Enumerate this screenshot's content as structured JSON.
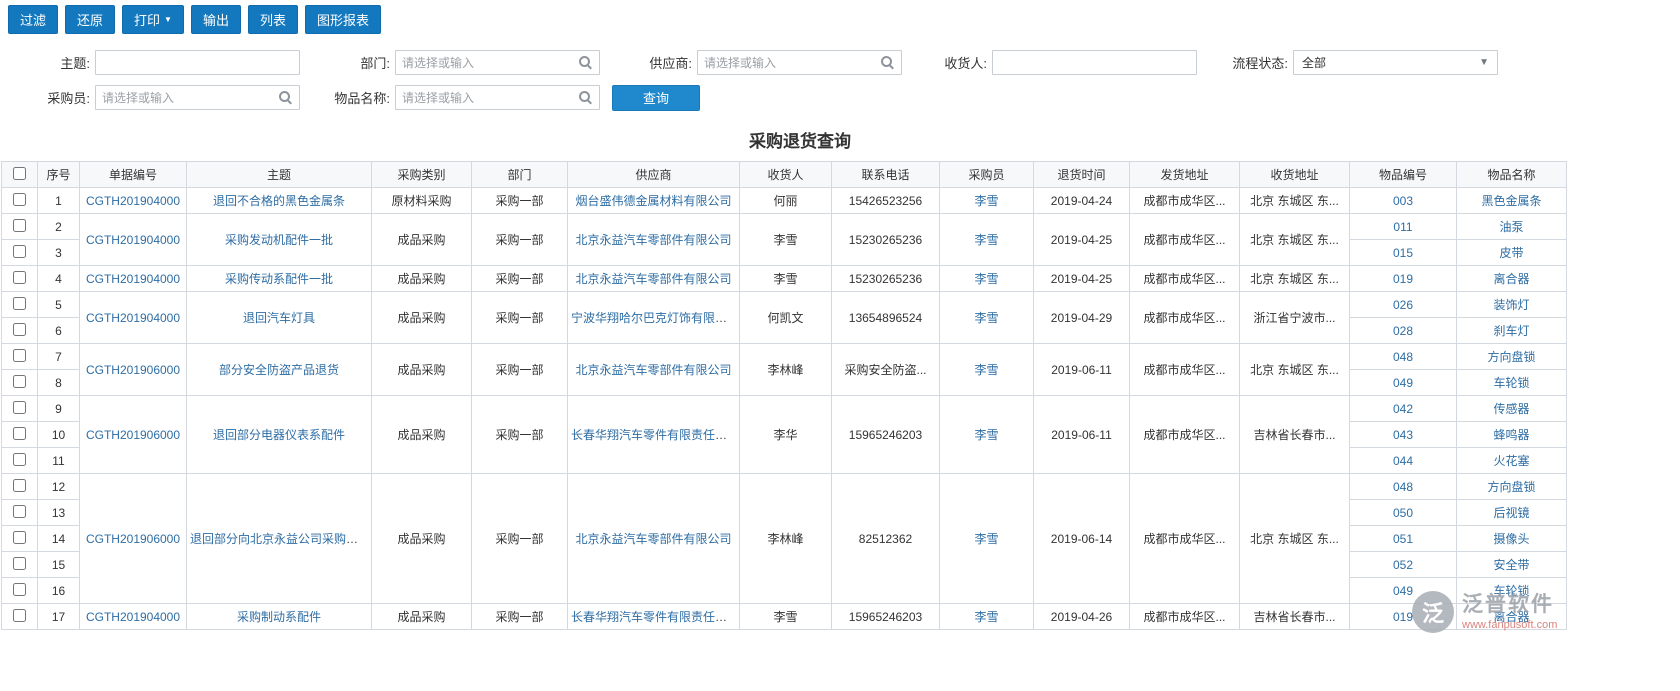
{
  "toolbar": {
    "buttons": [
      {
        "label": "过滤",
        "name": "filter-button"
      },
      {
        "label": "还原",
        "name": "restore-button"
      },
      {
        "label": "打印",
        "name": "print-button",
        "caret": true
      },
      {
        "label": "输出",
        "name": "output-button"
      },
      {
        "label": "列表",
        "name": "list-button"
      },
      {
        "label": "图形报表",
        "name": "graph-report-button"
      }
    ]
  },
  "filters": {
    "subject_label": "主题:",
    "dept_label": "部门:",
    "supplier_label": "供应商:",
    "consignee_label": "收货人:",
    "status_label": "流程状态:",
    "purchaser_label": "采购员:",
    "item_name_label": "物品名称:",
    "search_placeholder": "请选择或输入",
    "status_value": "全部",
    "query_button": "查询"
  },
  "page_title": "采购退货查询",
  "table": {
    "headers": [
      "序号",
      "单据编号",
      "主题",
      "采购类别",
      "部门",
      "供应商",
      "收货人",
      "联系电话",
      "采购员",
      "退货时间",
      "发货地址",
      "收货地址",
      "物品编号",
      "物品名称"
    ],
    "groups": [
      {
        "doc_no": "CGTH201904000",
        "subject": "退回不合格的黑色金属条",
        "category": "原材料采购",
        "dept": "采购一部",
        "supplier": "烟台盛伟德金属材料有限公司",
        "consignee": "何丽",
        "phone": "15426523256",
        "purchaser": "李雪",
        "return_date": "2019-04-24",
        "ship_address": "成都市成华区...",
        "recv_address": "北京 东城区 东...",
        "items": [
          {
            "no": "003",
            "name": "黑色金属条"
          }
        ]
      },
      {
        "doc_no": "CGTH201904000",
        "subject": "采购发动机配件一批",
        "category": "成品采购",
        "dept": "采购一部",
        "supplier": "北京永益汽车零部件有限公司",
        "consignee": "李雪",
        "phone": "15230265236",
        "purchaser": "李雪",
        "return_date": "2019-04-25",
        "ship_address": "成都市成华区...",
        "recv_address": "北京 东城区 东...",
        "items": [
          {
            "no": "011",
            "name": "油泵"
          },
          {
            "no": "015",
            "name": "皮带"
          }
        ]
      },
      {
        "doc_no": "CGTH201904000",
        "subject": "采购传动系配件一批",
        "category": "成品采购",
        "dept": "采购一部",
        "supplier": "北京永益汽车零部件有限公司",
        "consignee": "李雪",
        "phone": "15230265236",
        "purchaser": "李雪",
        "return_date": "2019-04-25",
        "ship_address": "成都市成华区...",
        "recv_address": "北京 东城区 东...",
        "items": [
          {
            "no": "019",
            "name": "离合器"
          }
        ]
      },
      {
        "doc_no": "CGTH201904000",
        "subject": "退回汽车灯具",
        "category": "成品采购",
        "dept": "采购一部",
        "supplier": "宁波华翔哈尔巴克灯饰有限公...",
        "consignee": "何凯文",
        "phone": "13654896524",
        "purchaser": "李雪",
        "return_date": "2019-04-29",
        "ship_address": "成都市成华区...",
        "recv_address": "浙江省宁波市...",
        "items": [
          {
            "no": "026",
            "name": "装饰灯"
          },
          {
            "no": "028",
            "name": "刹车灯"
          }
        ]
      },
      {
        "doc_no": "CGTH201906000",
        "subject": "部分安全防盗产品退货",
        "category": "成品采购",
        "dept": "采购一部",
        "supplier": "北京永益汽车零部件有限公司",
        "consignee": "李林峰",
        "phone": "采购安全防盗...",
        "purchaser": "李雪",
        "return_date": "2019-06-11",
        "ship_address": "成都市成华区...",
        "recv_address": "北京 东城区 东...",
        "items": [
          {
            "no": "048",
            "name": "方向盘锁"
          },
          {
            "no": "049",
            "name": "车轮锁"
          }
        ]
      },
      {
        "doc_no": "CGTH201906000",
        "subject": "退回部分电器仪表系配件",
        "category": "成品采购",
        "dept": "采购一部",
        "supplier": "长春华翔汽车零件有限责任公...",
        "consignee": "李华",
        "phone": "15965246203",
        "purchaser": "李雪",
        "return_date": "2019-06-11",
        "ship_address": "成都市成华区...",
        "recv_address": "吉林省长春市...",
        "items": [
          {
            "no": "042",
            "name": "传感器"
          },
          {
            "no": "043",
            "name": "蜂鸣器"
          },
          {
            "no": "044",
            "name": "火花塞"
          }
        ]
      },
      {
        "doc_no": "CGTH201906000",
        "subject": "退回部分向北京永益公司采购的安",
        "category": "成品采购",
        "dept": "采购一部",
        "supplier": "北京永益汽车零部件有限公司",
        "consignee": "李林峰",
        "phone": "82512362",
        "purchaser": "李雪",
        "return_date": "2019-06-14",
        "ship_address": "成都市成华区...",
        "recv_address": "北京 东城区 东...",
        "items": [
          {
            "no": "048",
            "name": "方向盘锁"
          },
          {
            "no": "050",
            "name": "后视镜"
          },
          {
            "no": "051",
            "name": "摄像头"
          },
          {
            "no": "052",
            "name": "安全带"
          },
          {
            "no": "049",
            "name": "车轮锁"
          }
        ]
      },
      {
        "doc_no": "CGTH201904000",
        "subject": "采购制动系配件",
        "category": "成品采购",
        "dept": "采购一部",
        "supplier": "长春华翔汽车零件有限责任公...",
        "consignee": "李雪",
        "phone": "15965246203",
        "purchaser": "李雪",
        "return_date": "2019-04-26",
        "ship_address": "成都市成华区...",
        "recv_address": "吉林省长春市...",
        "items": [
          {
            "no": "019",
            "name": "离合器"
          }
        ]
      }
    ]
  },
  "watermark": {
    "logo_char": "泛",
    "brand": "泛普软件",
    "url": "www.fanpusoft.com"
  }
}
